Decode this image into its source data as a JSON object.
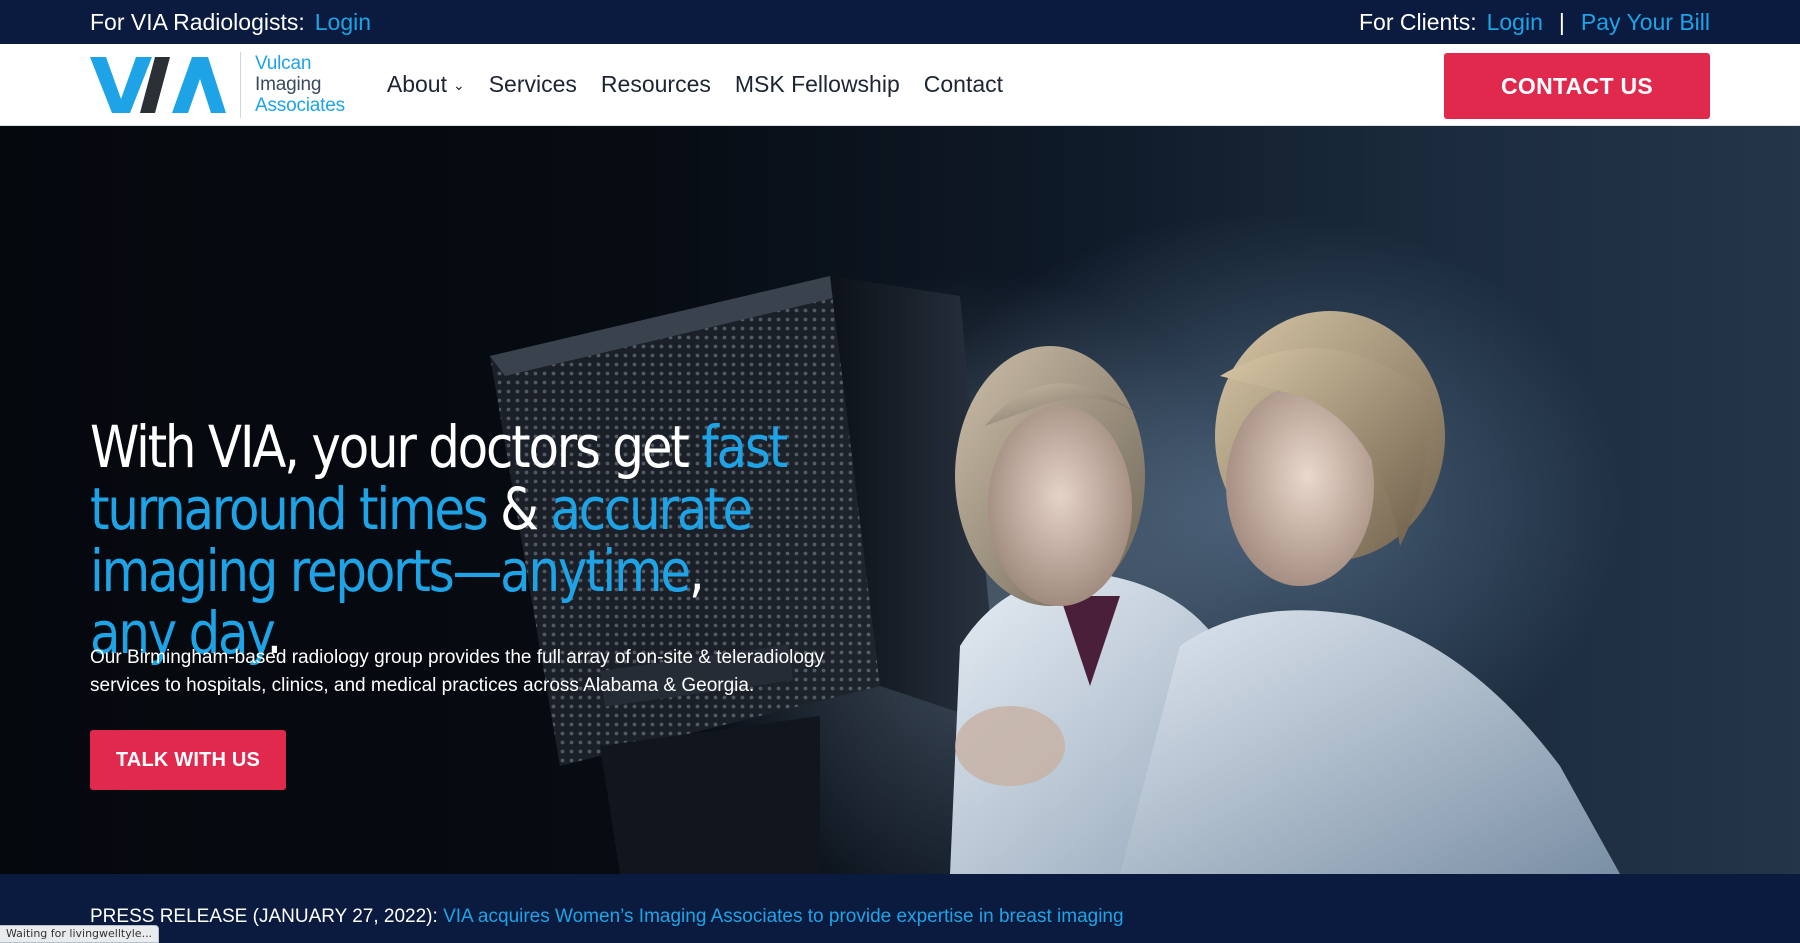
{
  "topbar": {
    "radiologists_label": "For VIA Radiologists:",
    "radiologists_login": "Login",
    "clients_label": "For Clients:",
    "clients_login": "Login",
    "separator": "|",
    "pay_bill": "Pay Your Bill"
  },
  "logo": {
    "line1": "Vulcan",
    "line2": "Imaging",
    "line3": "Associates"
  },
  "nav": {
    "items": [
      {
        "label": "About",
        "has_dropdown": true
      },
      {
        "label": "Services"
      },
      {
        "label": "Resources"
      },
      {
        "label": "MSK Fellowship"
      },
      {
        "label": "Contact"
      }
    ],
    "cta": "CONTACT US"
  },
  "hero": {
    "headline": {
      "p1": "With VIA, your doctors get ",
      "p2": "fast turnaround times",
      "p3": " & ",
      "p4": "accurate imaging reports",
      "p5": "—",
      "p6": "anytime",
      "p7": ", ",
      "p8": "any day",
      "p9": "."
    },
    "subtext": "Our Birmingham-based radiology group provides the full array of on-site & teleradiology services to hospitals, clinics, and medical practices across Alabama & Georgia.",
    "button": "TALK WITH US"
  },
  "press": {
    "prefix": "PRESS RELEASE (JANUARY 27, 2022): ",
    "link": "VIA acquires Women’s Imaging Associates to provide expertise in breast imaging"
  },
  "status": "Waiting for livingwelltyle...",
  "colors": {
    "navy": "#0b1b3f",
    "accent_blue": "#1ea4e6",
    "cta_red": "#e1294e"
  }
}
